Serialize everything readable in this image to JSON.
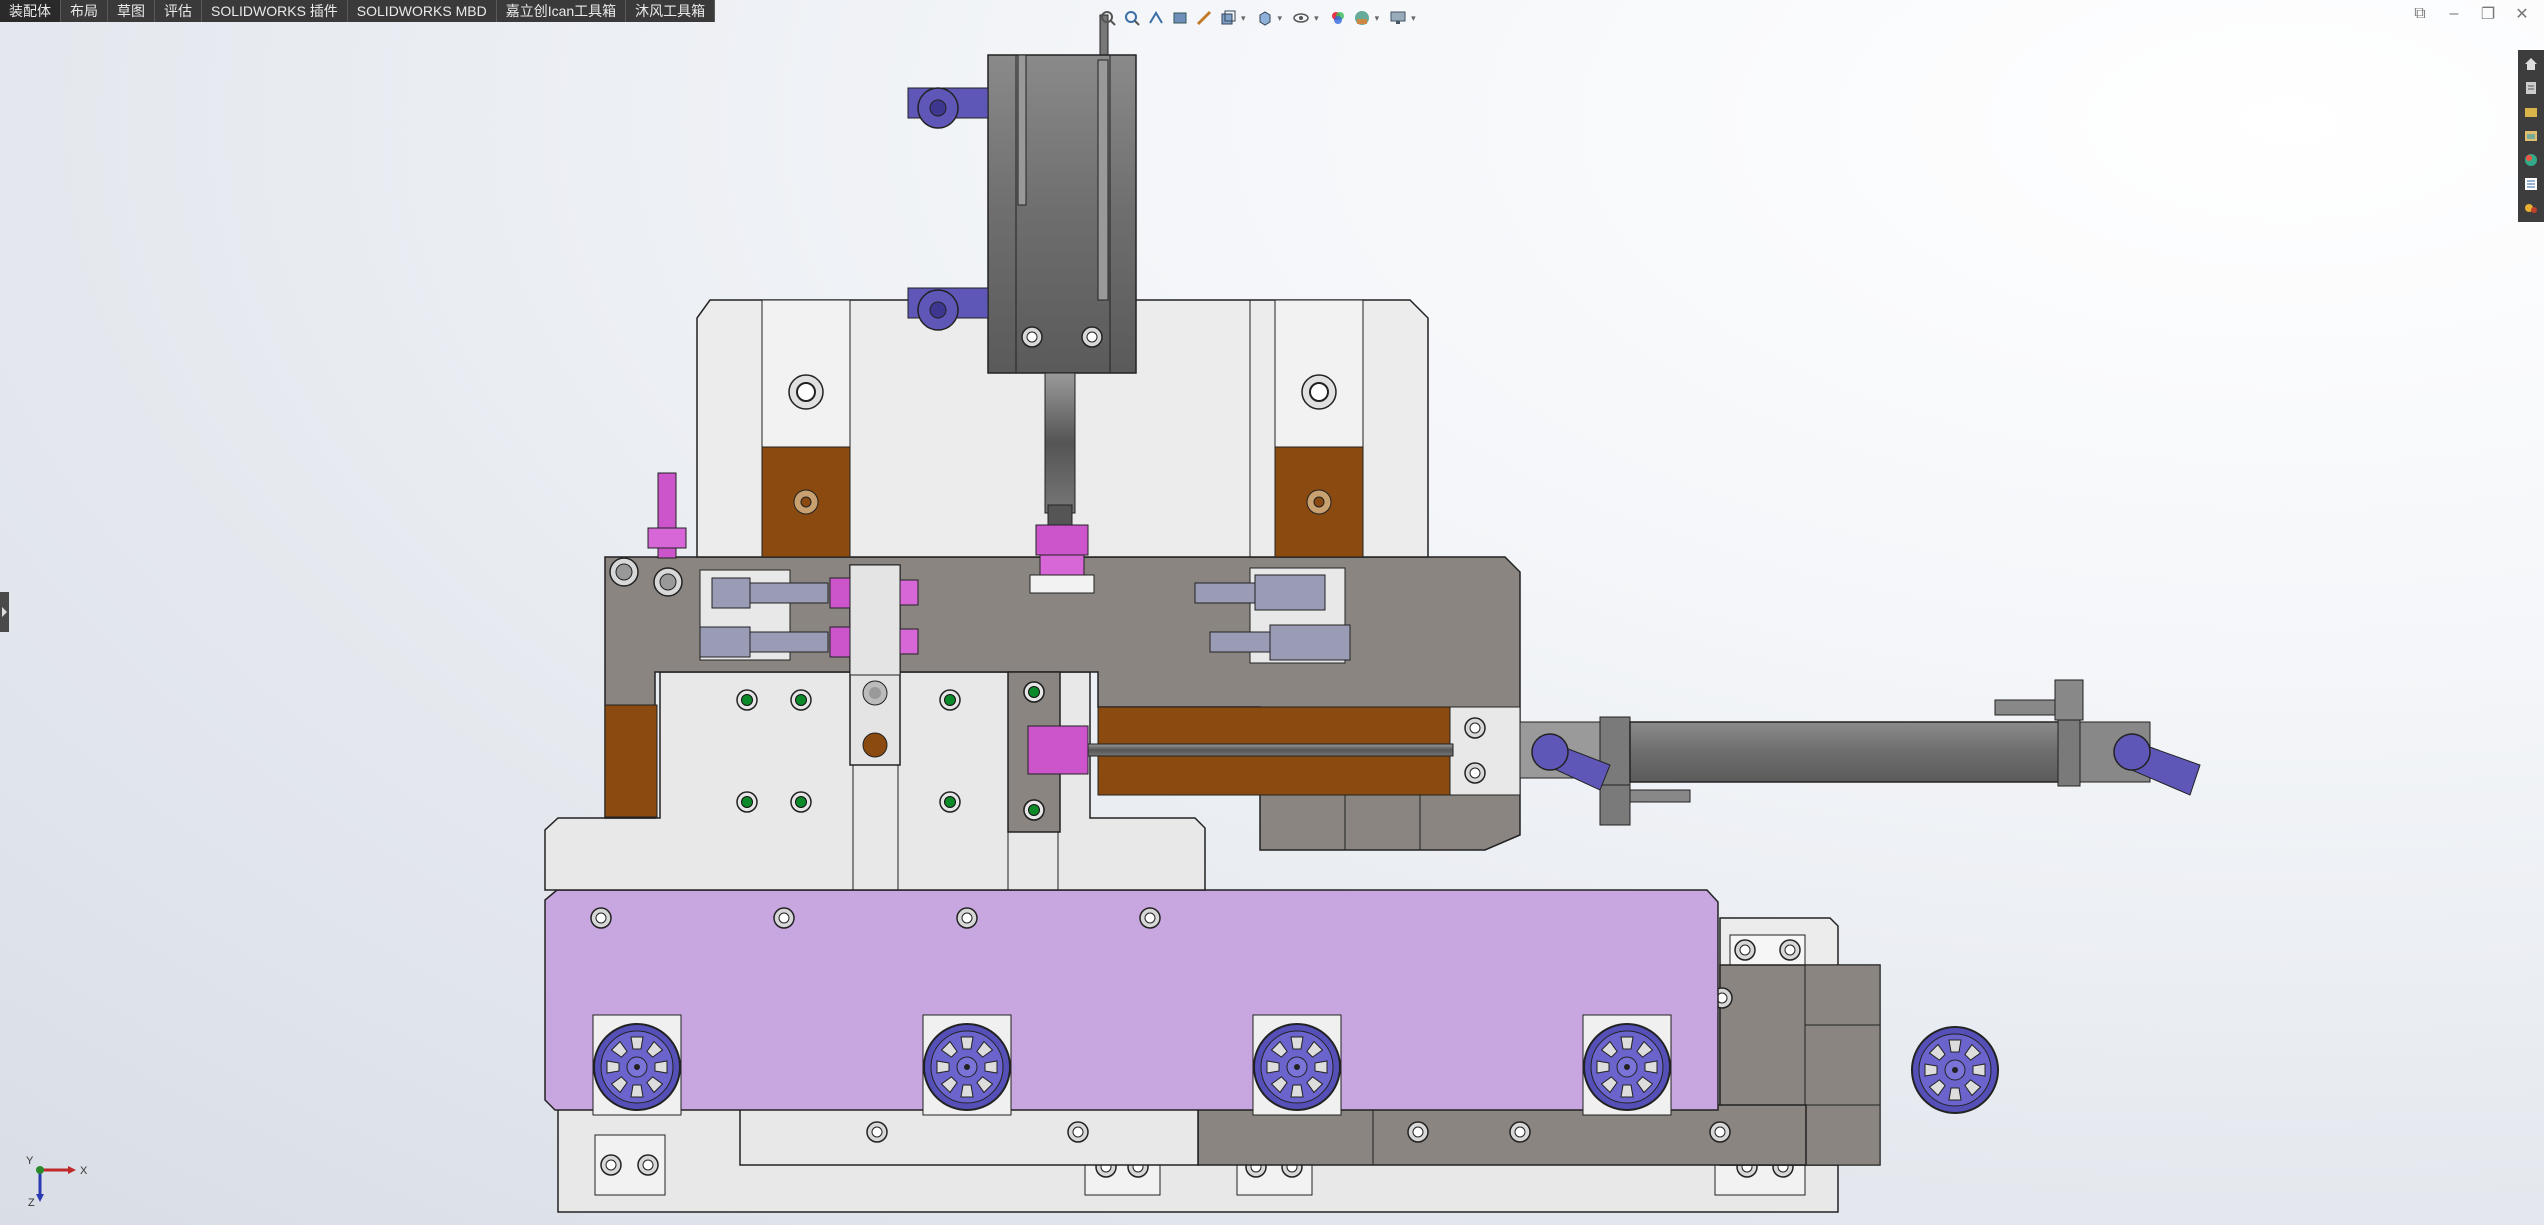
{
  "tabs": [
    {
      "label": "装配体"
    },
    {
      "label": "布局"
    },
    {
      "label": "草图"
    },
    {
      "label": "评估"
    },
    {
      "label": "SOLIDWORKS 插件"
    },
    {
      "label": "SOLIDWORKS MBD"
    },
    {
      "label": "嘉立创Ican工具箱"
    },
    {
      "label": "沐风工具箱"
    }
  ],
  "heads_up_toolbar": {
    "icons": [
      "zoom-to-fit-icon",
      "zoom-to-area-icon",
      "previous-view-icon",
      "section-view-icon",
      "dynamic-annotation-icon",
      "view-orientation-icon",
      "display-style-icon",
      "hide-show-icon",
      "edit-appearance-icon",
      "apply-scene-icon",
      "view-settings-icon"
    ]
  },
  "task_pane": {
    "icons": [
      "home-icon",
      "resources-icon",
      "design-library-icon",
      "file-explorer-icon",
      "appearances-icon",
      "custom-properties-icon",
      "add-ins-icon"
    ]
  },
  "triad": {
    "x_label": "X",
    "y_label": "Y",
    "z_label": "Z"
  },
  "colors": {
    "tab_bar": "#3a3a3a",
    "steel_dark": "#8c8782",
    "steel_light": "#e6e6e6",
    "copper": "#8b4a0f",
    "lavender": "#c8a6df",
    "fitting_blue": "#5f57b8",
    "fitting_magenta": "#cc55cc"
  }
}
